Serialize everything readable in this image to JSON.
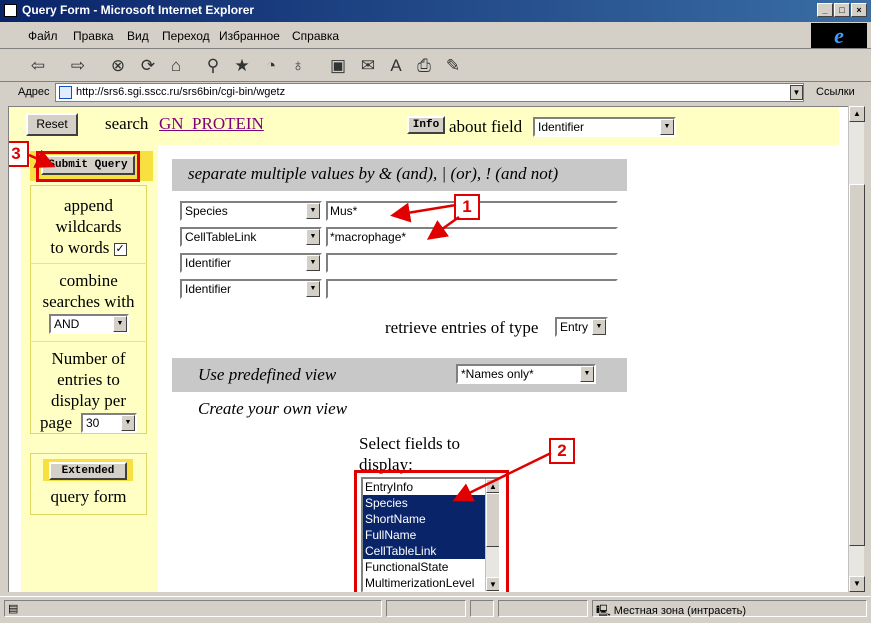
{
  "window": {
    "title": "Query Form - Microsoft Internet Explorer",
    "btn_min": "_",
    "btn_max": "□",
    "btn_close": "×"
  },
  "menu": [
    "Файл",
    "Правка",
    "Вид",
    "Переход",
    "Избранное",
    "Справка"
  ],
  "ie_logo": "e",
  "address": {
    "label": "Адрес",
    "url": "http://srs6.sgi.sscc.ru/srs6bin/cgi-bin/wgetz",
    "links_label": "Ссылки"
  },
  "form": {
    "reset_label": "Reset",
    "search_label": "search",
    "databank_link": "GN_PROTEIN",
    "info_label": "Info",
    "about_field_label": "about field",
    "about_field_value": "Identifier",
    "submit_label": "Submit Query",
    "wildcards_text": [
      "append",
      "wildcards",
      "to words"
    ],
    "wildcards_checked": "✓",
    "combine_text": [
      "combine",
      "searches with"
    ],
    "combine_value": "AND",
    "num_entries_text": [
      "Number of",
      "entries to",
      "display per"
    ],
    "page_label": "page",
    "page_value": "30",
    "extended_label": "Extended",
    "query_form_label": "query form",
    "separate_hint": "separate multiple values by & (and), | (or), ! (and not)",
    "rows": [
      {
        "field": "Species",
        "value": "Mus*"
      },
      {
        "field": "CellTableLink",
        "value": "*macrophage*"
      },
      {
        "field": "Identifier",
        "value": ""
      },
      {
        "field": "Identifier",
        "value": ""
      }
    ],
    "retrieve_label": "retrieve entries of type",
    "retrieve_value": "Entry",
    "predefined_label": "Use predefined view",
    "predefined_value": "*Names only*",
    "create_view_label": "Create your own view",
    "select_fields_label": [
      "Select fields to",
      "display:"
    ],
    "fields_list": [
      {
        "label": "EntryInfo",
        "selected": false
      },
      {
        "label": "Species",
        "selected": true
      },
      {
        "label": "ShortName",
        "selected": true
      },
      {
        "label": "FullName",
        "selected": true
      },
      {
        "label": "CellTableLink",
        "selected": true
      },
      {
        "label": "FunctionalState",
        "selected": false
      },
      {
        "label": "MultimerizationLevel",
        "selected": false
      }
    ]
  },
  "annotations": {
    "callout_1": "1",
    "callout_2": "2",
    "callout_3": "3",
    "color": "#e00000"
  },
  "status": {
    "zone": "Местная зона (интрасеть)"
  }
}
